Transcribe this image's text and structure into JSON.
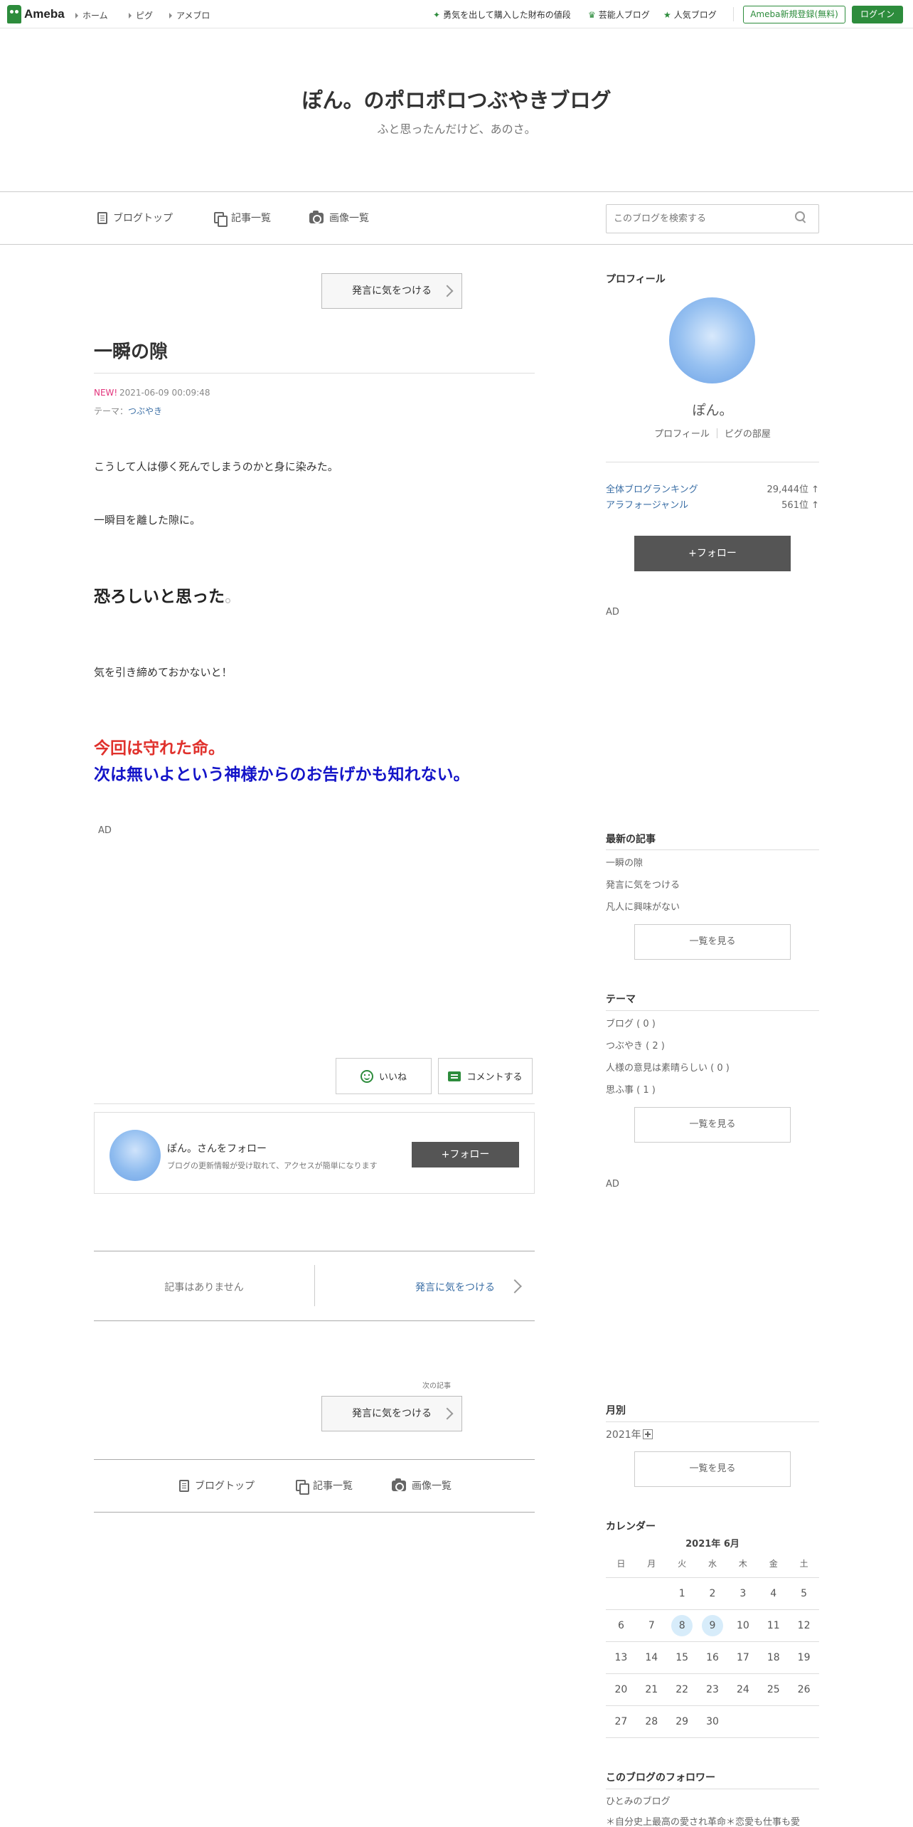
{
  "header": {
    "brand": "Ameba",
    "nav": [
      "ホーム",
      "ピグ",
      "アメブロ"
    ],
    "promos": [
      {
        "icon": "sparkle-icon",
        "label": "勇気を出して購入した財布の値段"
      },
      {
        "icon": "crown-icon",
        "label": "芸能人ブログ"
      },
      {
        "icon": "star-icon",
        "label": "人気ブログ"
      }
    ],
    "register_label": "Ameba新規登録(無料)",
    "login_label": "ログイン"
  },
  "blog": {
    "title": "ぽん。のポロポロつぶやきブログ",
    "description": "ふと思ったんだけど、あのさ。"
  },
  "blog_nav": {
    "items": [
      "ブログトップ",
      "記事一覧",
      "画像一覧"
    ],
    "search_placeholder": "このブログを検索する"
  },
  "entry": {
    "prev_link": "発言に気をつける",
    "title": "一瞬の隙",
    "new_badge": "NEW!",
    "date": "2021-06-09 00:09:48",
    "theme_prefix": "テーマ：",
    "theme": "つぶやき",
    "body": [
      "こうして人は儚く死んでしまうのかと身に染みた。",
      "一瞬目を離した隙に。",
      "恐ろしいと思った",
      "。",
      "気を引き締めておかないと！",
      "今回は守れた命。",
      "次は無いよという神様からのお告げかも知れない。"
    ],
    "ad_label": "AD",
    "like_label": "いいね",
    "comment_label": "コメントする",
    "follow_box": {
      "name": "ぽん。さんをフォロー",
      "desc": "ブログの更新情報が受け取れて、アクセスが簡単になります",
      "button": "+フォロー"
    },
    "pager": {
      "none": "記事はありません",
      "next": "発言に気をつける"
    },
    "next_article_label": "次の記事",
    "next_article": "発言に気をつける"
  },
  "footer_nav": [
    "ブログトップ",
    "記事一覧",
    "画像一覧"
  ],
  "sidebar": {
    "profile_heading": "プロフィール",
    "name": "ぽん。",
    "profile_link": "プロフィール",
    "pig_link": "ピグの部屋",
    "rankings": [
      {
        "label": "全体ブログランキング",
        "value": "29,444位 ↑"
      },
      {
        "label": "アラフォージャンル",
        "value": "561位 ↑"
      }
    ],
    "follow_button": "+フォロー",
    "ad_label": "AD",
    "recent_heading": "最新の記事",
    "recent": [
      "一瞬の隙",
      "発言に気をつける",
      "凡人に興味がない"
    ],
    "more_label": "一覧を見る",
    "theme_heading": "テーマ",
    "themes": [
      "ブログ ( 0 )",
      "つぶやき ( 2 )",
      "人様の意見は素晴らしい ( 0 )",
      "思ふ事 ( 1 )"
    ],
    "monthly_heading": "月別",
    "year": "2021年",
    "calendar_heading": "カレンダー",
    "calendar_title": "2021年 6月",
    "weekdays": [
      "日",
      "月",
      "火",
      "水",
      "木",
      "金",
      "土"
    ],
    "calendar_rows": [
      [
        "",
        "",
        "1",
        "2",
        "3",
        "4",
        "5"
      ],
      [
        "6",
        "7",
        "8",
        "9",
        "10",
        "11",
        "12"
      ],
      [
        "13",
        "14",
        "15",
        "16",
        "17",
        "18",
        "19"
      ],
      [
        "20",
        "21",
        "22",
        "23",
        "24",
        "25",
        "26"
      ],
      [
        "27",
        "28",
        "29",
        "30",
        "",
        "",
        ""
      ]
    ],
    "followers_heading": "このブログのフォロワー",
    "followers": [
      "ひとみのブログ",
      "＊自分史上最高の愛され革命＊恋愛も仕事も愛"
    ]
  }
}
